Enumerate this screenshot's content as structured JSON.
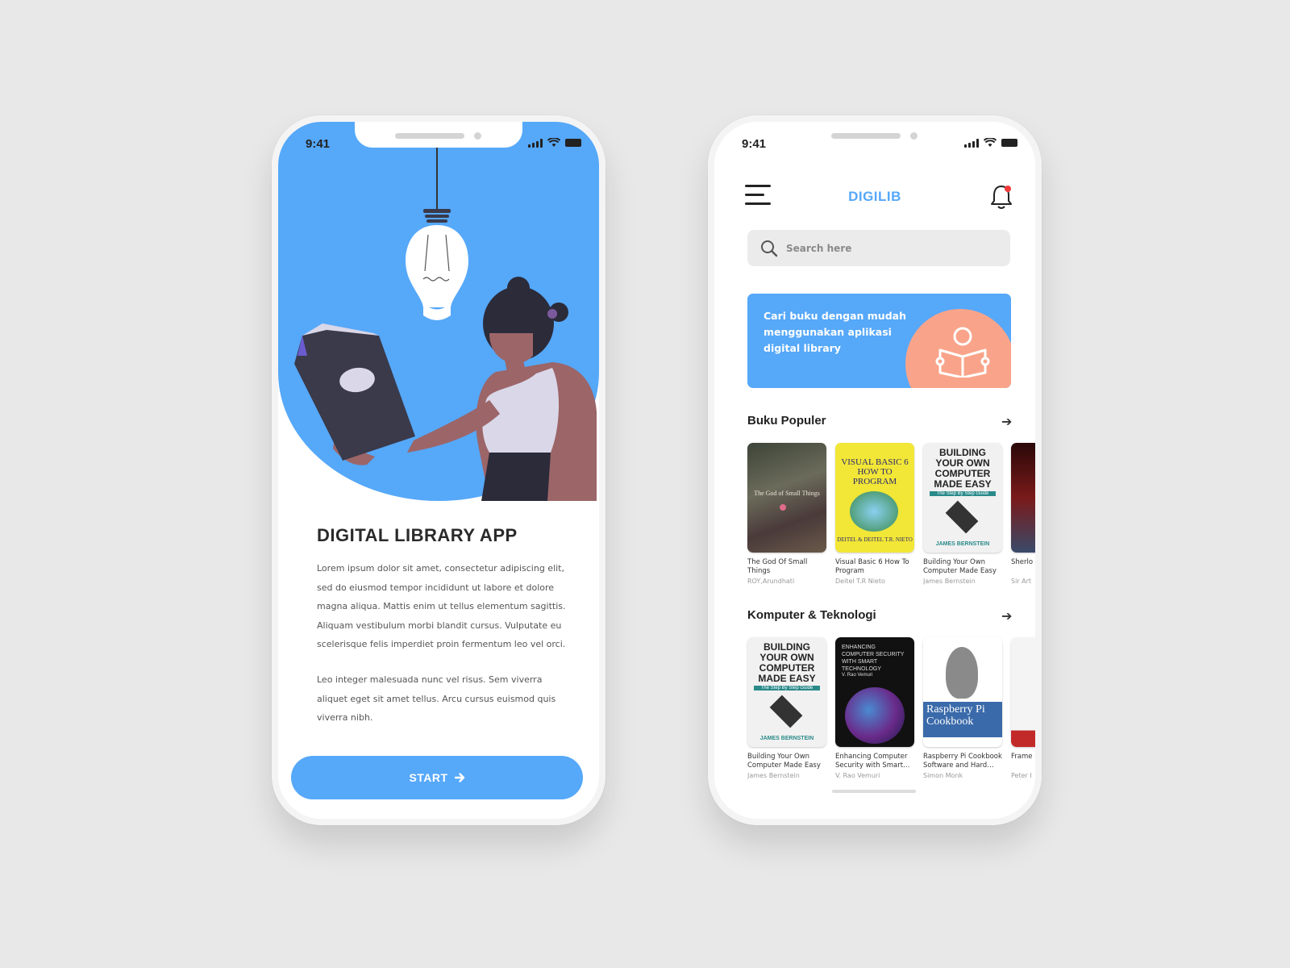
{
  "status_bar": {
    "time": "9:41"
  },
  "onboarding": {
    "title": "DIGITAL LIBRARY APP",
    "paragraph_1": "Lorem ipsum dolor sit amet, consectetur adipiscing elit, sed do eiusmod tempor incididunt ut labore et dolore magna aliqua. Mattis enim ut tellus elementum sagittis. Aliquam vestibulum morbi blandit cursus. Vulputate eu scelerisque felis imperdiet proin fermentum leo vel orci.",
    "paragraph_2": "Leo integer malesuada nunc vel risus. Sem viverra aliquet eget sit amet tellus. Arcu cursus euismod quis viverra nibh.",
    "start_label": "START",
    "accent": "#56a8f9"
  },
  "home": {
    "app_title": "DIGILIB",
    "search_placeholder": "Search here",
    "banner_text": "Cari buku dengan mudah menggunakan aplikasi digital library",
    "banner_colors": {
      "bg": "#56a8f9",
      "circle": "#f9a48a"
    },
    "sections": [
      {
        "title": "Buku Populer",
        "books": [
          {
            "title": "The God Of Small Things",
            "author": "ROY,Arundhati"
          },
          {
            "title": "Visual Basic 6 How To Program",
            "author": "Deitel T.R Nieto"
          },
          {
            "title": "Building Your Own Computer Made Easy",
            "author": "James Bernstein"
          },
          {
            "title": "Sherlo Koleks",
            "author": "Sir Art"
          }
        ]
      },
      {
        "title": "Komputer & Teknologi",
        "books": [
          {
            "title": "Building Your Own Computer Made Easy",
            "author": "James Bernstein"
          },
          {
            "title": "Enhancing Computer Security with Smart…",
            "author": "V. Rao Vemuri"
          },
          {
            "title": "Raspberry Pi Cookbook Software and Hard…",
            "author": "Simon Monk"
          },
          {
            "title": "Frame Monit",
            "author": "Peter I"
          }
        ]
      }
    ],
    "cover_text": {
      "vb": "VISUAL BASIC 6 HOW TO PROGRAM",
      "vb_authors": "DEITEL & DEITEL T.R. NIETO",
      "byoc": "BUILDING YOUR OWN COMPUTER MADE EASY",
      "byoc_sub": "The Step By Step Guide",
      "byoc_author": "JAMES BERNSTEIN",
      "god": "The God of Small Things",
      "ecs": "ENHANCING COMPUTER SECURITY WITH SMART TECHNOLOGY",
      "ecs_author": "V. Rao Vemuri",
      "rpi": "Raspberry Pi Cookbook"
    },
    "icons": [
      "menu-icon",
      "bell-icon",
      "search-icon",
      "reader-icon",
      "arrow-right-icon"
    ]
  }
}
